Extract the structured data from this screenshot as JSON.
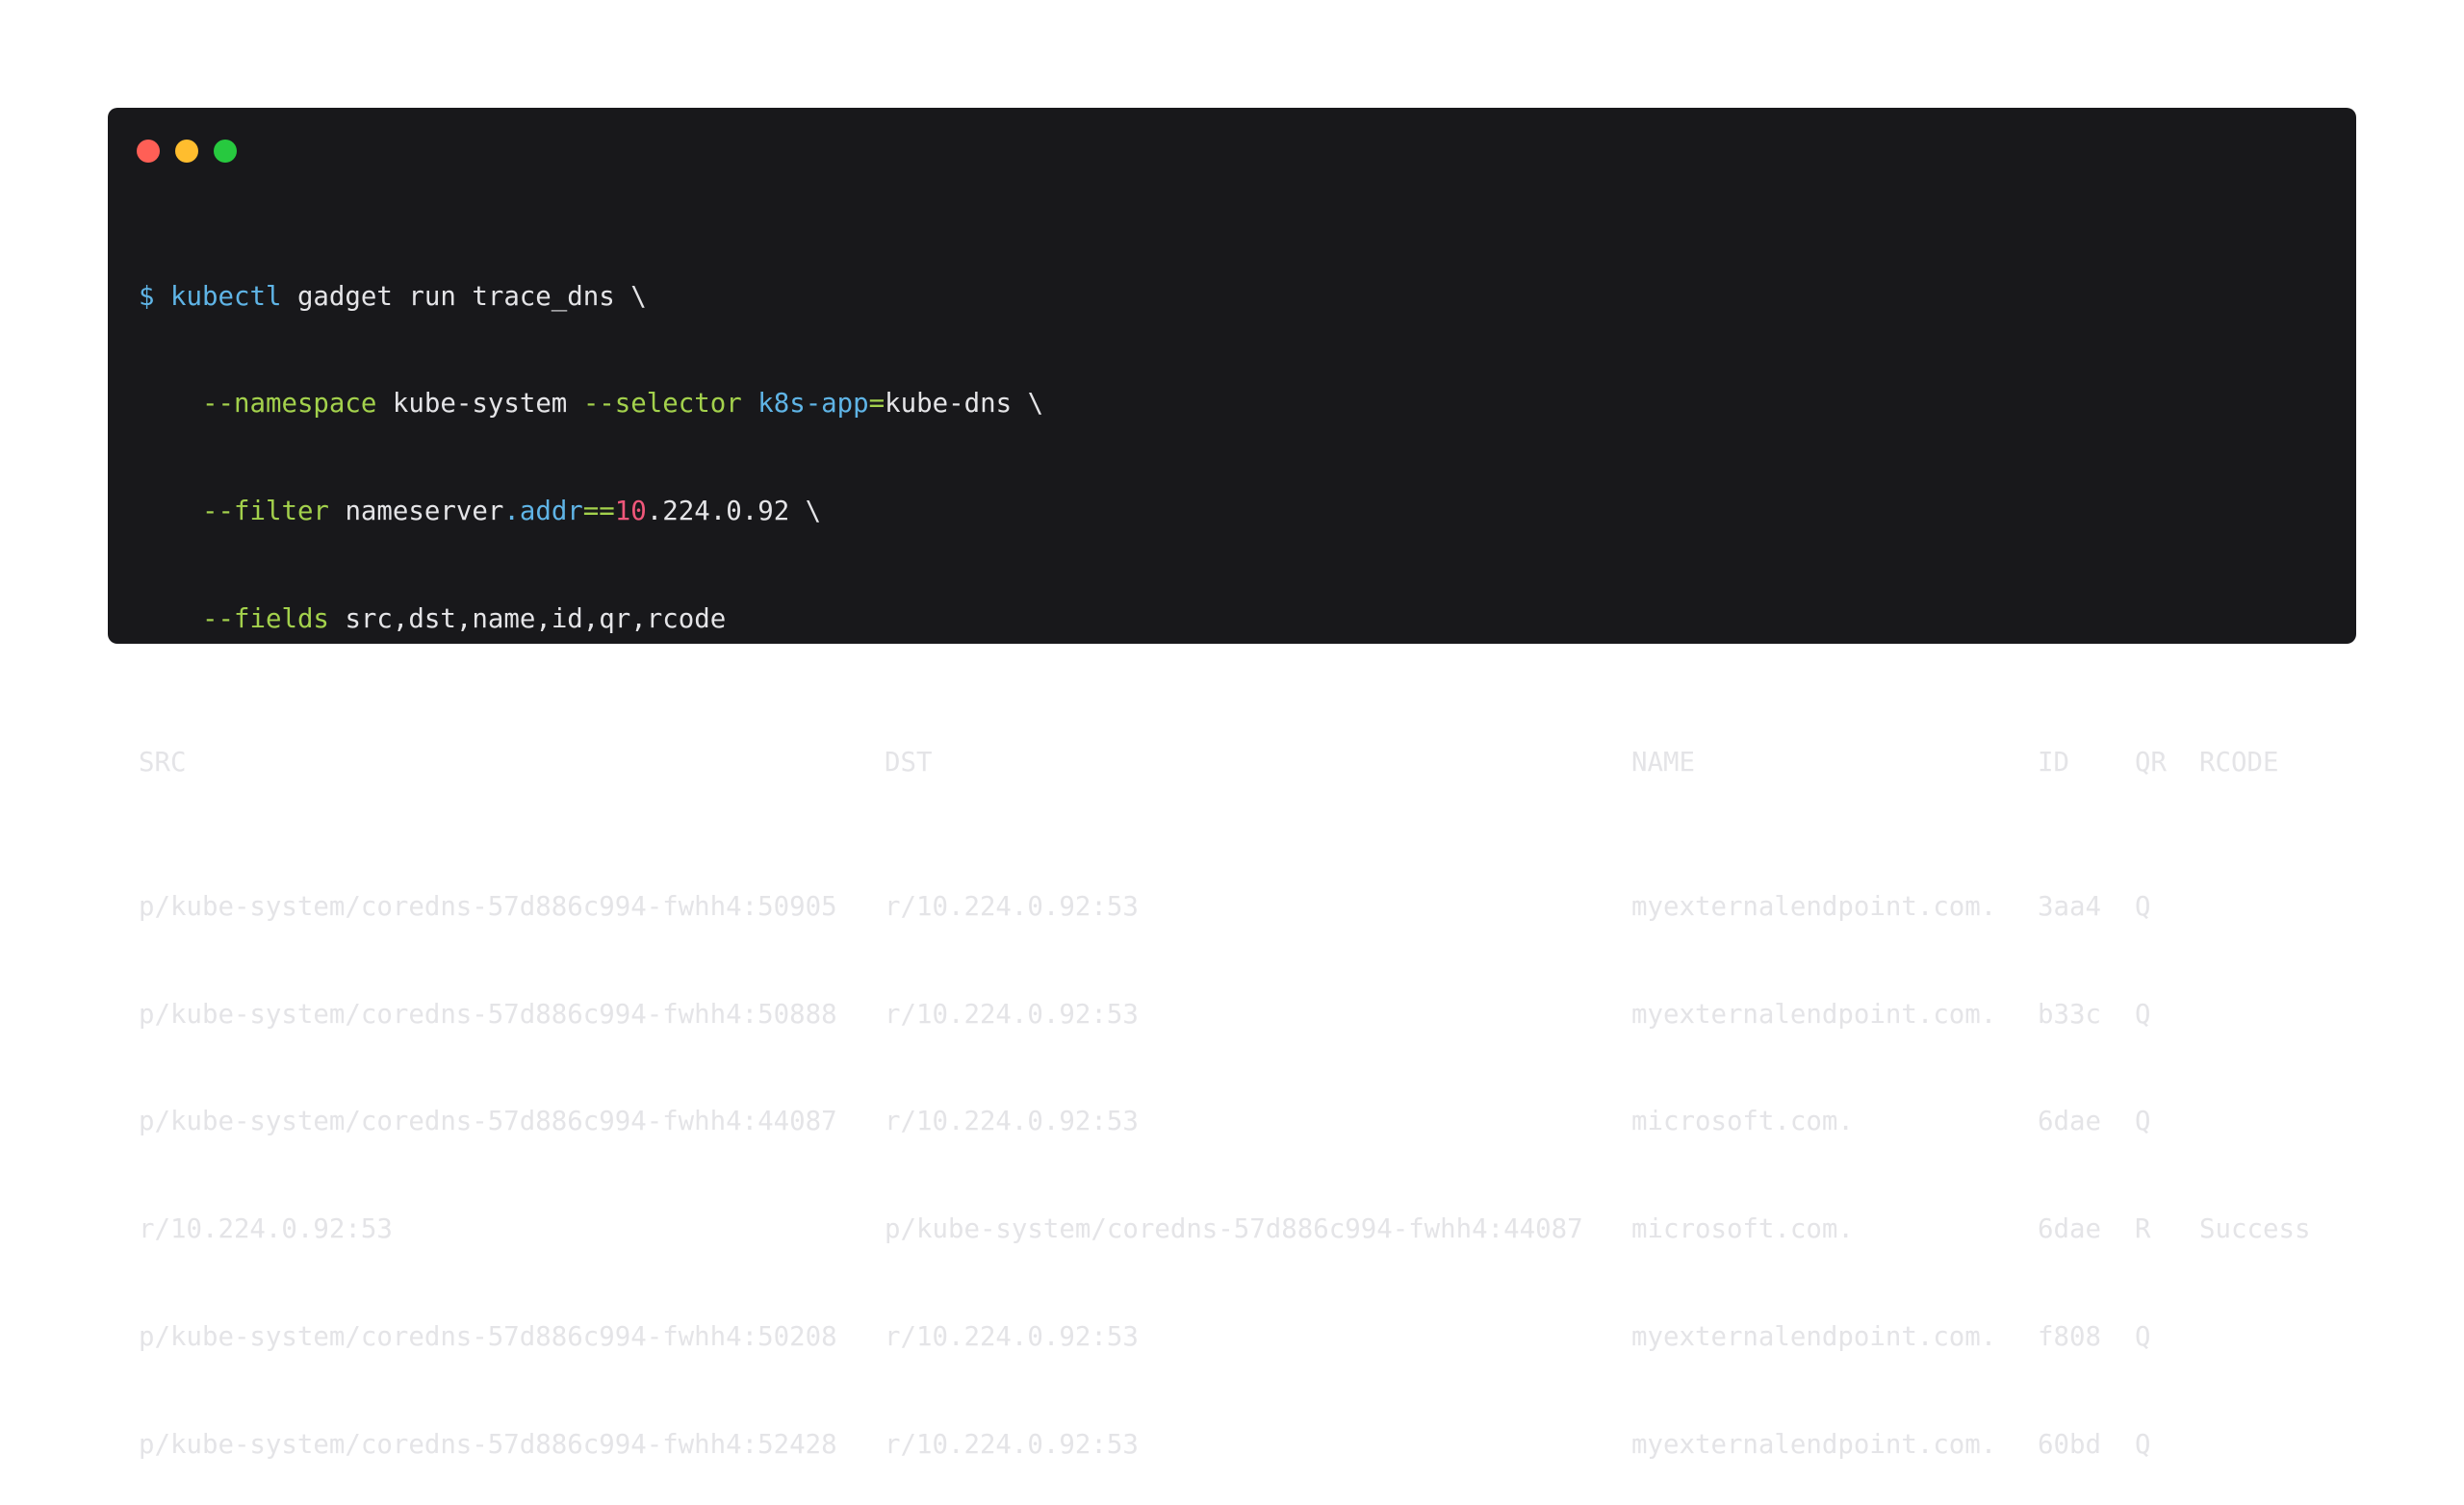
{
  "window": {
    "controls": [
      {
        "name": "close",
        "color": "#ff5f56"
      },
      {
        "name": "minimize",
        "color": "#ffbd2e"
      },
      {
        "name": "maximize",
        "color": "#27c93f"
      }
    ]
  },
  "command": {
    "line1": {
      "prompt": "$",
      "cmd": "kubectl",
      "rest": "gadget run trace_dns \\"
    },
    "line2": {
      "flag1": "--namespace",
      "val1": "kube-system",
      "flag2": "--selector",
      "key": "k8s-app",
      "eq": "=",
      "val2": "kube-dns \\"
    },
    "line3": {
      "flag": "--filter",
      "obj": "nameserver",
      "field": ".addr",
      "op": "==",
      "num": "10",
      "rest": ".224.0.92 \\"
    },
    "line4": {
      "flag": "--fields",
      "val": "src,dst,name,id,qr,rcode"
    }
  },
  "table": {
    "headers": [
      "SRC",
      "DST",
      "NAME",
      "ID",
      "QR",
      "RCODE"
    ],
    "rows": [
      [
        "p/kube-system/coredns-57d886c994-fwhh4:50905",
        "r/10.224.0.92:53",
        "myexternalendpoint.com.",
        "3aa4",
        "Q",
        ""
      ],
      [
        "p/kube-system/coredns-57d886c994-fwhh4:50888",
        "r/10.224.0.92:53",
        "myexternalendpoint.com.",
        "b33c",
        "Q",
        ""
      ],
      [
        "p/kube-system/coredns-57d886c994-fwhh4:44087",
        "r/10.224.0.92:53",
        "microsoft.com.",
        "6dae",
        "Q",
        ""
      ],
      [
        "r/10.224.0.92:53",
        "p/kube-system/coredns-57d886c994-fwhh4:44087",
        "microsoft.com.",
        "6dae",
        "R",
        "Success"
      ],
      [
        "p/kube-system/coredns-57d886c994-fwhh4:50208",
        "r/10.224.0.92:53",
        "myexternalendpoint.com.",
        "f808",
        "Q",
        ""
      ],
      [
        "p/kube-system/coredns-57d886c994-fwhh4:52428",
        "r/10.224.0.92:53",
        "myexternalendpoint.com.",
        "60bd",
        "Q",
        ""
      ]
    ]
  }
}
